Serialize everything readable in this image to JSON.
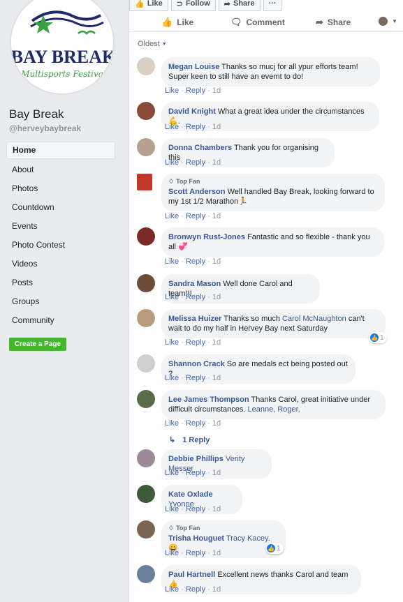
{
  "page": {
    "name": "Bay Break",
    "handle": "@herveybaybreak",
    "logo_text": "BAY BREAK",
    "logo_subtext": "Multisports Festival"
  },
  "nav": {
    "items": [
      "Home",
      "About",
      "Photos",
      "Countdown",
      "Events",
      "Photo Contest",
      "Videos",
      "Posts",
      "Groups",
      "Community"
    ],
    "create_page": "Create a Page"
  },
  "top_buttons": {
    "like": "Like",
    "follow": "Follow",
    "share": "Share",
    "more": "···"
  },
  "actions": {
    "like": "Like",
    "comment": "Comment",
    "share": "Share"
  },
  "sort": {
    "label": "Oldest"
  },
  "meta_labels": {
    "like": "Like",
    "reply": "Reply",
    "sep": "·"
  },
  "replies": {
    "label": "1 Reply"
  },
  "top_fan_label": "Top Fan",
  "comments": [
    {
      "author": "Megan Louise",
      "text": "Thanks so mucj for all ypur efforts team! Super keen to still have an evemt to do!",
      "time": "1d"
    },
    {
      "author": "David Knight",
      "text": "What a great idea under the circumstances 💪.",
      "time": "1d"
    },
    {
      "author": "Donna Chambers",
      "text": "Thank you for organising this",
      "time": "1d"
    },
    {
      "author": "Scott Anderson",
      "text": "Well handled Bay Break, looking forward to my 1st 1/2 Marathon🏃",
      "time": "1d",
      "top_fan": true
    },
    {
      "author": "Bronwyn Rust-Jones",
      "text": "Fantastic and so flexible - thank you all 💞",
      "time": "1d"
    },
    {
      "author": "Sandra Mason",
      "text": "Well done Carol and team!!!",
      "time": "1d"
    },
    {
      "author": "Melissa Huizer",
      "text_pre": "Thanks so much",
      "tag": "Carol McNaughton",
      "text": "can't wait to do my half in Hervey Bay next Saturday",
      "time": "1d",
      "reactions": "1"
    },
    {
      "author": "Shannon Crack",
      "text": "So are medals ect being posted out ?",
      "time": "1d"
    },
    {
      "author": "Lee James Thompson",
      "text": "Thanks Carol, great initiative under difficult circumstances.",
      "tag": "Leanne, Roger,",
      "time": "1d"
    },
    {
      "author": "Debbie Phillips",
      "tag": "Verity Messer",
      "time": "1d"
    },
    {
      "author": "Kate Oxlade",
      "tag": "Yvonne",
      "time": "1d"
    },
    {
      "author": "Trisha Houguet",
      "tag": "Tracy Kacey.",
      "text": "😄",
      "time": "1d",
      "top_fan": true,
      "reactions": "1"
    },
    {
      "author": "Paul Hartnell",
      "text": "Excellent news thanks Carol and team👍",
      "time": "1d"
    }
  ],
  "colors": {
    "link": "#385898",
    "bubble": "#f2f3f5",
    "create_page": "#42b72a",
    "like_blue": "#1877f2"
  }
}
